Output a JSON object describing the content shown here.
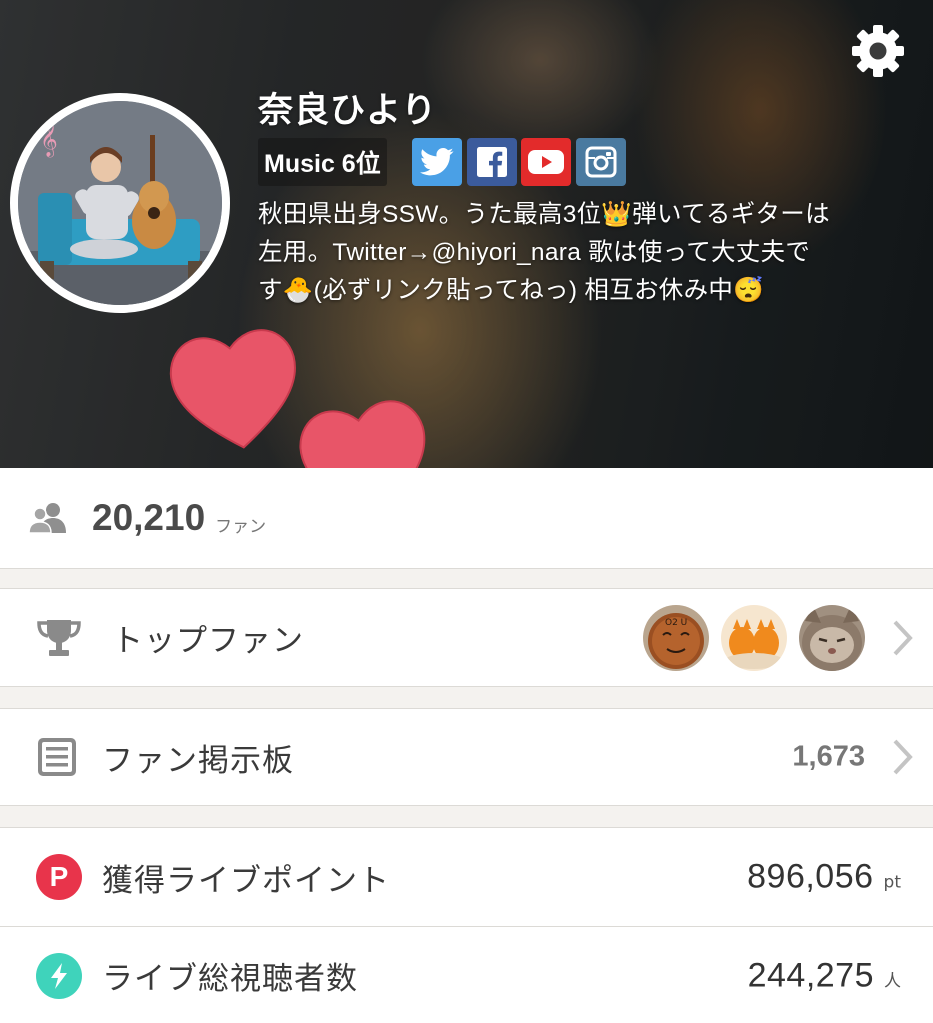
{
  "header": {
    "settings_icon": "gear-icon",
    "profile": {
      "name": "奈良ひより",
      "rank": "Music 6位",
      "bio": "秋田県出身SSW。うた最高3位👑弾いてるギターは\n左用。Twitter→@hiyori_nara 歌は使って大丈夫で\nす🐣(必ずリンク貼ってねっ) 相互お休み中😴"
    },
    "social_links": [
      {
        "icon": "twitter-icon",
        "color": "#4aa0e6"
      },
      {
        "icon": "facebook-icon",
        "color": "#3b5b9c"
      },
      {
        "icon": "youtube-icon",
        "color": "#e32b2b"
      },
      {
        "icon": "instagram-icon",
        "color": "#4a7aa0"
      }
    ],
    "decoration": "heart-icon"
  },
  "fans": {
    "icon": "people-icon",
    "count": "20,210",
    "unit": "ファン"
  },
  "top_fans": {
    "icon": "trophy-icon",
    "label": "トップファン",
    "avatars": [
      "fan-avatar-1",
      "fan-avatar-2",
      "fan-avatar-3"
    ]
  },
  "fan_board": {
    "icon": "board-icon",
    "label": "ファン掲示板",
    "count": "1,673"
  },
  "stats": {
    "points": {
      "icon": "points-icon",
      "icon_letter": "P",
      "label": "獲得ライブポイント",
      "value": "896,056",
      "unit": "pt",
      "color": "#e8344b"
    },
    "viewers": {
      "icon": "lightning-icon",
      "label": "ライブ総視聴者数",
      "value": "244,275",
      "unit": "人",
      "color": "#3fd3bb"
    }
  },
  "colors": {
    "accent_heart": "#e85568",
    "divider_background": "#f4f2ef"
  }
}
